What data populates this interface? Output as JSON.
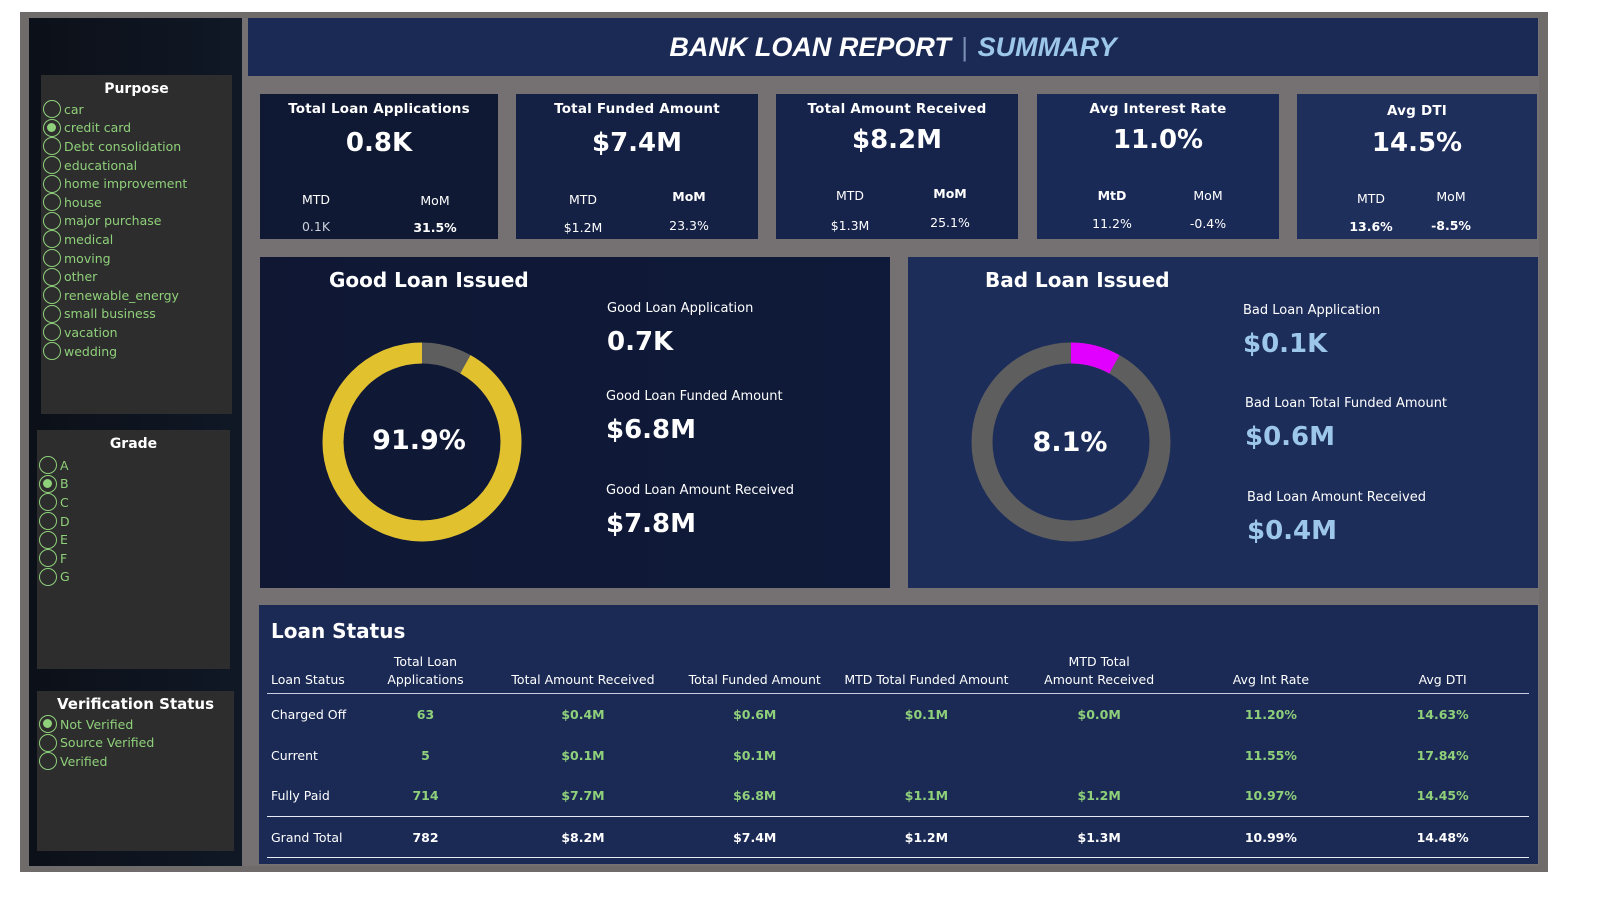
{
  "header": {
    "title": "BANK LOAN REPORT",
    "separator": "|",
    "subtitle": "SUMMARY"
  },
  "filters": {
    "purpose": {
      "title": "Purpose",
      "options": [
        {
          "label": "car",
          "selected": false
        },
        {
          "label": "credit card",
          "selected": true
        },
        {
          "label": "Debt consolidation",
          "selected": false
        },
        {
          "label": "educational",
          "selected": false
        },
        {
          "label": "home improvement",
          "selected": false
        },
        {
          "label": "house",
          "selected": false
        },
        {
          "label": "major purchase",
          "selected": false
        },
        {
          "label": "medical",
          "selected": false
        },
        {
          "label": "moving",
          "selected": false
        },
        {
          "label": "other",
          "selected": false
        },
        {
          "label": "renewable_energy",
          "selected": false
        },
        {
          "label": "small business",
          "selected": false
        },
        {
          "label": "vacation",
          "selected": false
        },
        {
          "label": "wedding",
          "selected": false
        }
      ]
    },
    "grade": {
      "title": "Grade",
      "options": [
        {
          "label": "A",
          "selected": false
        },
        {
          "label": "B",
          "selected": true
        },
        {
          "label": "C",
          "selected": false
        },
        {
          "label": "D",
          "selected": false
        },
        {
          "label": "E",
          "selected": false
        },
        {
          "label": "F",
          "selected": false
        },
        {
          "label": "G",
          "selected": false
        }
      ]
    },
    "verification": {
      "title": "Verification Status",
      "options": [
        {
          "label": "Not Verified",
          "selected": true
        },
        {
          "label": "Source Verified",
          "selected": false
        },
        {
          "label": "Verified",
          "selected": false
        }
      ]
    }
  },
  "kpis": [
    {
      "label": "Total Loan Applications",
      "value": "0.8K",
      "mtd_label": "MTD",
      "mom_label": "MoM",
      "mtd": "0.1K",
      "mom": "31.5%"
    },
    {
      "label": "Total Funded Amount",
      "value": "$7.4M",
      "mtd_label": "MTD",
      "mom_label": "MoM",
      "mtd": "$1.2M",
      "mom": "23.3%"
    },
    {
      "label": "Total Amount Received",
      "value": "$8.2M",
      "mtd_label": "MTD",
      "mom_label": "MoM",
      "mtd": "$1.3M",
      "mom": "25.1%"
    },
    {
      "label": "Avg Interest Rate",
      "value": "11.0%",
      "mtd_label": "MtD",
      "mom_label": "MoM",
      "mtd": "11.2%",
      "mom": "-0.4%"
    },
    {
      "label": "Avg DTI",
      "value": "14.5%",
      "mtd_label": "MTD",
      "mom_label": "MoM",
      "mtd": "13.6%",
      "mom": "-8.5%"
    }
  ],
  "good_loan": {
    "title": "Good Loan Issued",
    "percent": "91.9%",
    "percent_value": 91.9,
    "ring_color": "#e2c12f",
    "track_color": "#5e5e5e",
    "application_label": "Good Loan Application",
    "application_value": "0.7K",
    "funded_label": "Good Loan Funded Amount",
    "funded_value": "$6.8M",
    "received_label": "Good Loan Amount Received",
    "received_value": "$7.8M"
  },
  "bad_loan": {
    "title": "Bad Loan Issued",
    "percent": "8.1%",
    "percent_value": 8.1,
    "ring_color": "#e100ff",
    "track_color": "#5e5e5e",
    "application_label": "Bad Loan Application",
    "application_value": "$0.1K",
    "funded_label": "Bad Loan Total Funded Amount",
    "funded_value": "$0.6M",
    "received_label": "Bad Loan Amount Received",
    "received_value": "$0.4M"
  },
  "loan_status": {
    "title": "Loan Status",
    "columns": [
      "Loan Status",
      "Total Loan Applications",
      "Total Amount Received",
      "Total Funded Amount",
      "MTD Total Funded Amount",
      "MTD Total Amount Received",
      "Avg Int Rate",
      "Avg DTI"
    ],
    "rows": [
      [
        "Charged Off",
        "63",
        "$0.4M",
        "$0.6M",
        "$0.1M",
        "$0.0M",
        "11.20%",
        "14.63%"
      ],
      [
        "Current",
        "5",
        "$0.1M",
        "$0.1M",
        "",
        "",
        "11.55%",
        "17.84%"
      ],
      [
        "Fully Paid",
        "714",
        "$7.7M",
        "$6.8M",
        "$1.1M",
        "$1.2M",
        "10.97%",
        "14.45%"
      ]
    ],
    "total": [
      "Grand Total",
      "782",
      "$8.2M",
      "$7.4M",
      "$1.2M",
      "$1.3M",
      "10.99%",
      "14.48%"
    ]
  },
  "colors": {
    "panel_dark": "#0f1933",
    "panel_navy": "#1b2a55",
    "filter_green": "#8fd07a",
    "header_accent": "#9dc7ea"
  }
}
